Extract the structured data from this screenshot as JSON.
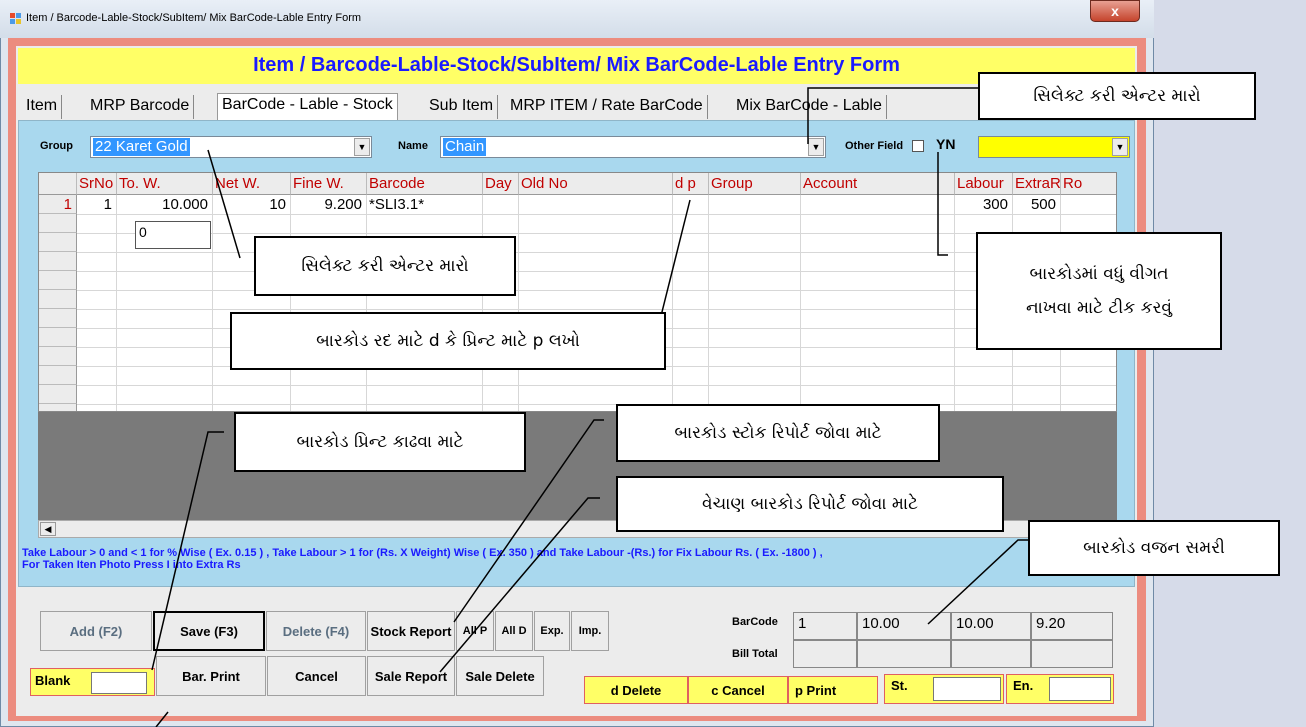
{
  "window": {
    "title": "Item / Barcode-Lable-Stock/SubItem/ Mix BarCode-Lable Entry Form",
    "close_label": "x"
  },
  "header": {
    "title": "Item / Barcode-Lable-Stock/SubItem/ Mix BarCode-Lable Entry Form"
  },
  "tabs": [
    "Item",
    "MRP Barcode",
    "BarCode - Lable - Stock",
    "Sub Item",
    "MRP ITEM / Rate BarCode",
    "Mix BarCode - Lable"
  ],
  "filters": {
    "group_label": "Group",
    "group_value": "22 Karet Gold",
    "name_label": "Name",
    "name_value": "Chain",
    "other_field_label": "Other Field",
    "yn_label": "YN"
  },
  "grid": {
    "columns": [
      "SrNo",
      "To. W.",
      "Net W.",
      "Fine W.",
      "Barcode",
      "Day",
      "Old No",
      "d p",
      "Group",
      "Account",
      "Labour",
      "ExtraR",
      "Ro"
    ],
    "row": {
      "index": "1",
      "srno": "1",
      "to_w": "10.000",
      "net_w": "10",
      "fine_w": "9.200",
      "barcode": "*SLI3.1*",
      "labour": "300",
      "extra": "500"
    },
    "edit_value": "0"
  },
  "hint": {
    "line1": "Take Labour  > 0 and < 1 for  % Wise ( Ex. 0.15 ) , Take Labour  > 1  for (Rs. X Weight)  Wise  ( Ex. 350 ) and Take Labour  -(Rs.)  for Fix Labour Rs. ( Ex. -1800 ) ,",
    "line2": "For Taken Iten Photo Press I into Extra Rs"
  },
  "buttons": {
    "add": "Add (F2)",
    "save": "Save (F3)",
    "delete": "Delete (F4)",
    "stock_report": "Stock Report",
    "all_p": "All P",
    "all_d": "All D",
    "exp": "Exp.",
    "imp": "Imp.",
    "bar_print": "Bar. Print",
    "cancel": "Cancel",
    "sale_report": "Sale Report",
    "sale_delete": "Sale Delete",
    "d_delete": "d Delete",
    "c_cancel": "c Cancel",
    "p_print": "p Print"
  },
  "blank": {
    "label": "Blank",
    "value": ""
  },
  "range": {
    "start_label": "St.",
    "end_label": "En."
  },
  "summary": {
    "barcode_label": "BarCode",
    "bill_total_label": "Bill Total",
    "values": [
      "1",
      "10.00",
      "10.00",
      "9.20"
    ]
  },
  "callouts": {
    "select_enter_top": "સિલેક્ટ કરી એન્ટર મારો",
    "select_enter_grid": "સિલેક્ટ કરી એન્ટર મારો",
    "other_field_tick_line1": "બારકોડમાં વધું વીગત",
    "other_field_tick_line2": "નાખવા માટે ટીક કરવું",
    "dp_hint": "બારકોડ રદ માટે d કે પ્રિન્ટ માટે p લખો",
    "barcode_print": "બારકોડ પ્રિન્ટ કાઢવા માટે",
    "stock_report": "બારકોડ સ્ટોક રિપોર્ટ જોવા માટે",
    "sale_report": "વેચાણ બારકોડ રિપોર્ટ જોવા માટે",
    "weight_summary": "બારકોડ વજન સમરી"
  },
  "colors": {
    "header_bg": "#ffff66",
    "header_text": "#1a1aff",
    "frame": "#ec8c7f",
    "panel": "#a9d8ee",
    "column_header_text": "#c00000"
  }
}
